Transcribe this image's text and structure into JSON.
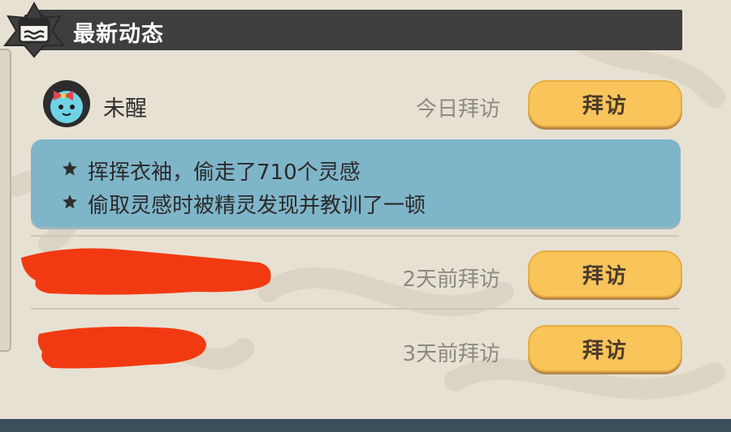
{
  "header": {
    "title": "最新动态",
    "icon": "calendar-icon"
  },
  "entries": [
    {
      "name": "未醒",
      "time": "今日拜访",
      "button": "拜访",
      "details": [
        "挥挥衣袖，偷走了710个灵感",
        "偷取灵感时被精灵发现并教训了一顿"
      ]
    },
    {
      "name": "",
      "time": "2天前拜访",
      "button": "拜访"
    },
    {
      "name": "",
      "time": "3天前拜访",
      "button": "拜访"
    }
  ],
  "colors": {
    "background": "#e7e1d3",
    "header_bar": "#3e3e3e",
    "button": "#f9c45a",
    "info_box": "#7fb5c9",
    "redaction": "#f23a12"
  }
}
